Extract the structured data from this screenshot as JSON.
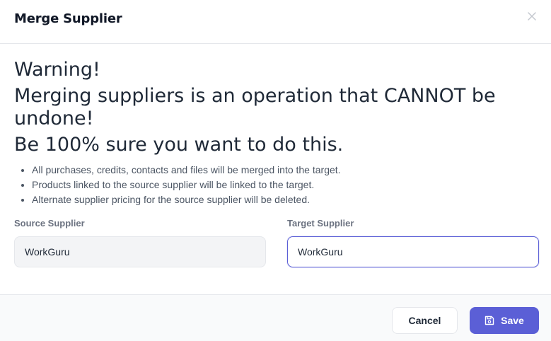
{
  "modal": {
    "title": "Merge Supplier"
  },
  "warning": {
    "line1": "Warning!",
    "line2": "Merging suppliers is an operation that CANNOT be undone!",
    "line3": "Be 100% sure you want to do this.",
    "bullets": [
      "All purchases, credits, contacts and files will be merged into the target.",
      "Products linked to the source supplier will be linked to the target.",
      "Alternate supplier pricing for the source supplier will be deleted."
    ]
  },
  "source": {
    "label": "Source Supplier",
    "value": "WorkGuru"
  },
  "target": {
    "label": "Target Supplier",
    "value": "WorkGuru"
  },
  "footer": {
    "cancel_label": "Cancel",
    "save_label": "Save"
  },
  "colors": {
    "primary": "#5b5fd6",
    "text": "#1f2937",
    "muted": "#6b7280"
  },
  "icons": {
    "close": "close-icon",
    "save": "floppy-disk-icon"
  }
}
